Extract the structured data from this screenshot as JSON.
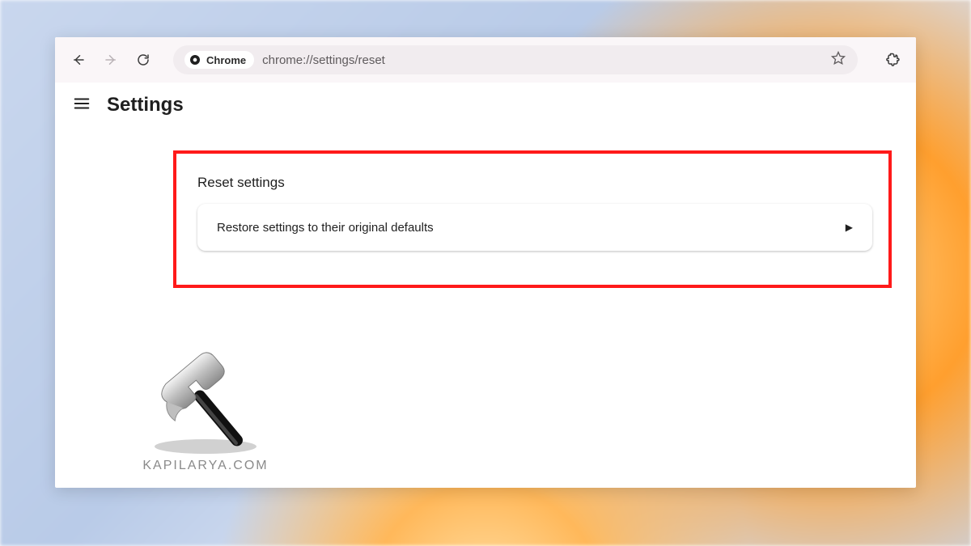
{
  "omnibox": {
    "chip_label": "Chrome",
    "url": "chrome://settings/reset"
  },
  "page": {
    "title": "Settings"
  },
  "reset": {
    "section_title": "Reset settings",
    "restore_label": "Restore settings to their original defaults"
  },
  "watermark": {
    "text": "KAPILARYA.COM"
  }
}
